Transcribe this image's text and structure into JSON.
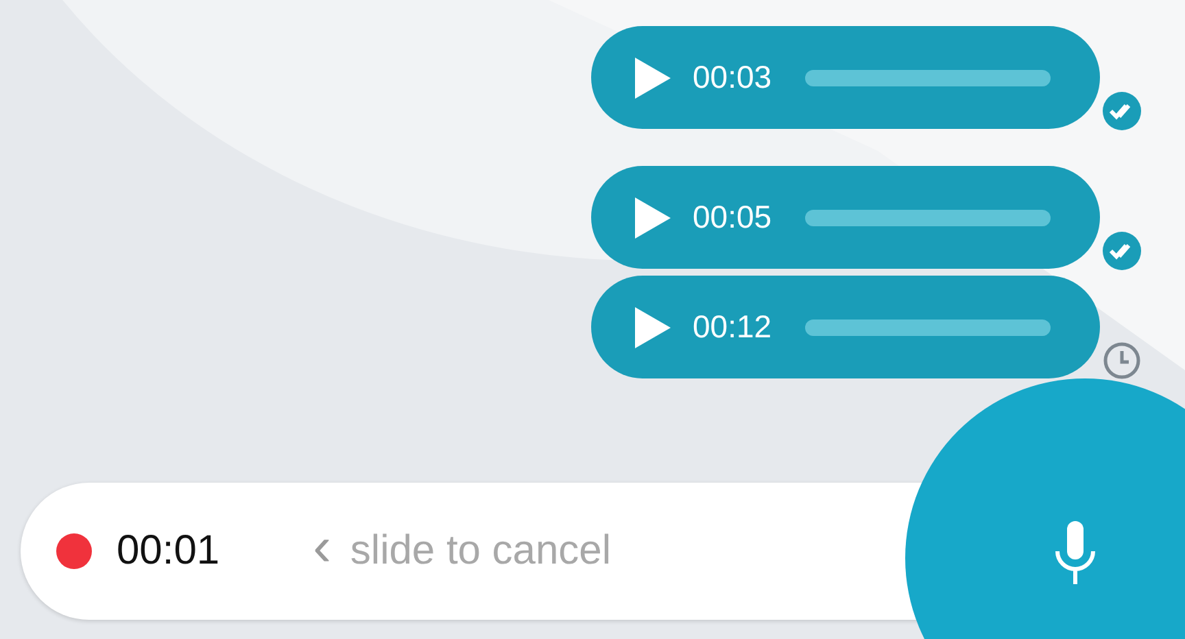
{
  "messages": [
    {
      "duration": "00:03",
      "read": true
    },
    {
      "duration": "00:05",
      "read": true
    },
    {
      "duration": "00:12",
      "read": false
    }
  ],
  "recorder": {
    "recording": true,
    "elapsed": "00:01",
    "hint_arrow": "‹",
    "hint": "slide to cancel"
  }
}
